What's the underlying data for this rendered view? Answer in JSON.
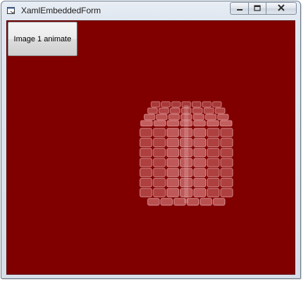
{
  "window": {
    "title": "XamlEmbeddedForm",
    "background_color": "#800000"
  },
  "caption_buttons": {
    "minimize_icon": "minimize-icon",
    "maximize_icon": "maximize-icon",
    "close_icon": "close-icon"
  },
  "content": {
    "animate_button_label": "Image 1 animate"
  },
  "cube": {
    "color": "#f2a0a0"
  }
}
